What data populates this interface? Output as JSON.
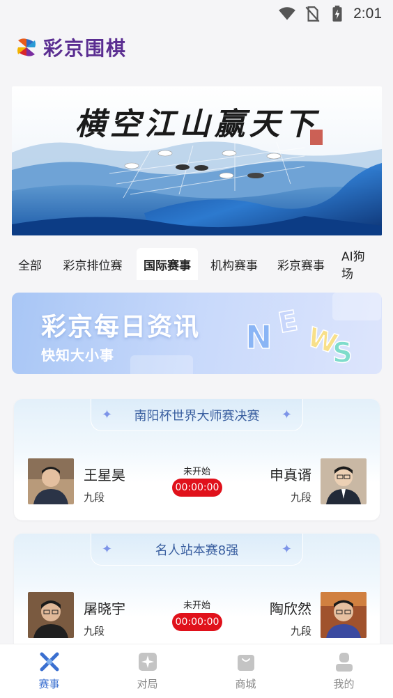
{
  "status_bar": {
    "time": "2:01",
    "icons": [
      "wifi-icon",
      "no-sim-icon",
      "battery-charging-icon"
    ]
  },
  "header": {
    "app_name": "彩京围棋",
    "logo_icon": "pinwheel-logo-icon"
  },
  "banner": {
    "calligraphy": "横空江山赢天下"
  },
  "category_tabs": [
    {
      "label": "全部"
    },
    {
      "label": "彩京排位赛"
    },
    {
      "label": "国际赛事",
      "active": true
    },
    {
      "label": "机构赛事"
    },
    {
      "label": "彩京赛事"
    },
    {
      "label": "AI狗场"
    }
  ],
  "news_banner": {
    "title": "彩京每日资讯",
    "subtitle": "快知大小事",
    "decor": "NEWS"
  },
  "matches": [
    {
      "title": "南阳杯世界大师赛决赛",
      "status": "未开始",
      "timer": "00:00:00",
      "left_player": {
        "name": "王星昊",
        "rank": "九段"
      },
      "right_player": {
        "name": "申真谞",
        "rank": "九段"
      }
    },
    {
      "title": "名人站本赛8强",
      "status": "未开始",
      "timer": "00:00:00",
      "left_player": {
        "name": "屠晓宇",
        "rank": "九段"
      },
      "right_player": {
        "name": "陶欣然",
        "rank": "九段"
      }
    }
  ],
  "bottom_nav": [
    {
      "label": "赛事",
      "icon": "crossed-swords-icon",
      "active": true
    },
    {
      "label": "对局",
      "icon": "go-board-icon"
    },
    {
      "label": "商城",
      "icon": "shopping-bag-icon"
    },
    {
      "label": "我的",
      "icon": "user-profile-icon"
    }
  ],
  "colors": {
    "accent": "#3a6fd0",
    "brand": "#5a2d91",
    "timer_red": "#e0111b"
  }
}
